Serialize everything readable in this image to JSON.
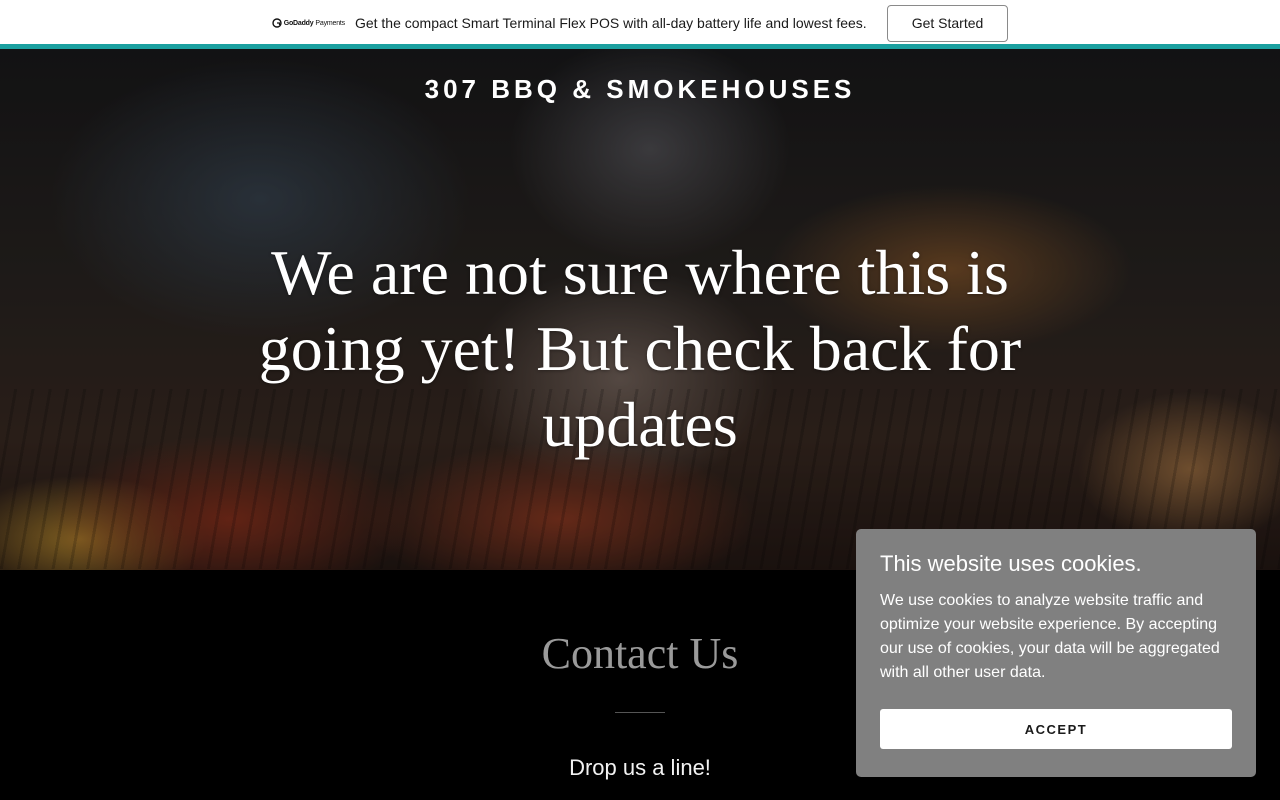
{
  "promo": {
    "brand_name": "GoDaddy",
    "brand_sub": "Payments",
    "text": "Get the compact Smart Terminal Flex POS with all-day battery life and lowest fees.",
    "button_label": "Get Started",
    "accent_color": "#1ba0a0"
  },
  "hero": {
    "site_title": "307 BBQ & SMOKEHOUSES",
    "headline": "We are not sure where this is going yet! But check back for updates"
  },
  "contact": {
    "title": "Contact Us",
    "subtitle": "Drop us a line!"
  },
  "cookie_banner": {
    "title": "This website uses cookies.",
    "body": "We use cookies to analyze website traffic and optimize your website experience. By accepting our use of cookies, your data will be aggregated with all other user data.",
    "accept_label": "ACCEPT",
    "background_color": "#808080"
  },
  "icons": {
    "brand_logo": "godaddy-logo-icon"
  }
}
